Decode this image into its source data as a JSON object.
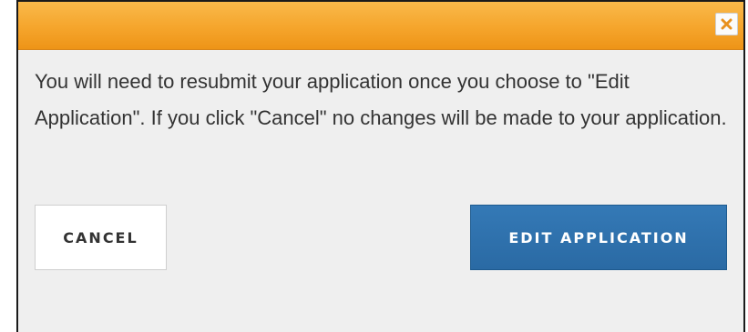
{
  "dialog": {
    "message": "You will need to resubmit your application once you choose to \"Edit Application\". If you click \"Cancel\" no changes will be made to your application.",
    "close_icon": "close-icon",
    "cancel_label": "CANCEL",
    "edit_label": "EDIT APPLICATION"
  },
  "colors": {
    "titlebar": "#f5a52c",
    "close_icon": "#e8911e",
    "primary_button": "#2d6fa9",
    "background": "#efefef"
  }
}
